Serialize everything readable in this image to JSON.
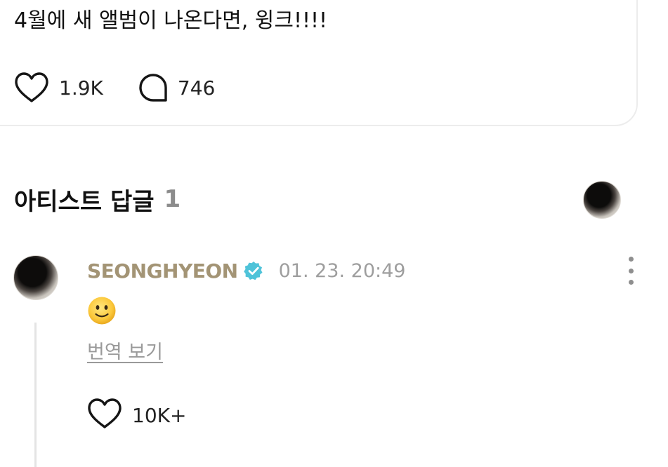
{
  "post": {
    "text": "4월에 새 앨범이 나온다면, 윙크!!!!",
    "likes": "1.9K",
    "comments": "746"
  },
  "artist_replies": {
    "title": "아티스트 답글",
    "count": "1"
  },
  "reply": {
    "author": "SEONGHYEON",
    "timestamp": "01. 23. 20:49",
    "emoji": "slightly-smiling-face",
    "translate_label": "번역 보기",
    "likes": "10K+"
  },
  "colors": {
    "author_name": "#a39475",
    "verified_badge": "#4fc3d9",
    "muted_text": "#9e9e9e"
  }
}
